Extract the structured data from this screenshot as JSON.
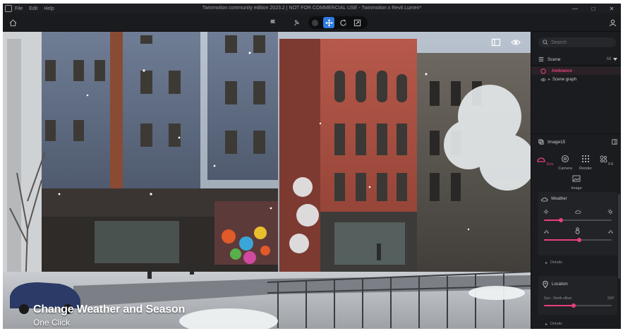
{
  "titlebar": {
    "menus": [
      "File",
      "Edit",
      "Help"
    ],
    "title": "Twinmotion community edition 2023.2 | NOT FOR COMMERCIAL USE - Twinmotion x Revit Lumen*",
    "controls": [
      "—",
      "□",
      "✕"
    ]
  },
  "viewport": {
    "caption_title": "Change Weather and Season",
    "caption_sub": "One Click"
  },
  "panel": {
    "search_placeholder": "Search",
    "scene_label": "Scene",
    "scene_filter": "All",
    "ambiance_label": "Ambiance",
    "scene_graph_label": "Scene graph",
    "image_label": "Image15",
    "tabs": [
      {
        "label": "Env",
        "icon": "env-icon"
      },
      {
        "label": "Camera",
        "icon": "camera-icon"
      },
      {
        "label": "Render",
        "icon": "render-icon"
      },
      {
        "label": "FX",
        "icon": "fx-icon"
      },
      {
        "label": "Image",
        "icon": "image-icon"
      }
    ],
    "weather_label": "Weather",
    "weather_value": 0.25,
    "season_value": 0.52,
    "details_label": "Details",
    "location_label": "Location",
    "north_offset_label": "Sun - North offset",
    "north_offset_value": "159°",
    "north_offset_fraction": 0.44,
    "details_label_2": "Details"
  },
  "colors": {
    "accent": "#e8407a",
    "active_tool": "#2f7be0"
  }
}
